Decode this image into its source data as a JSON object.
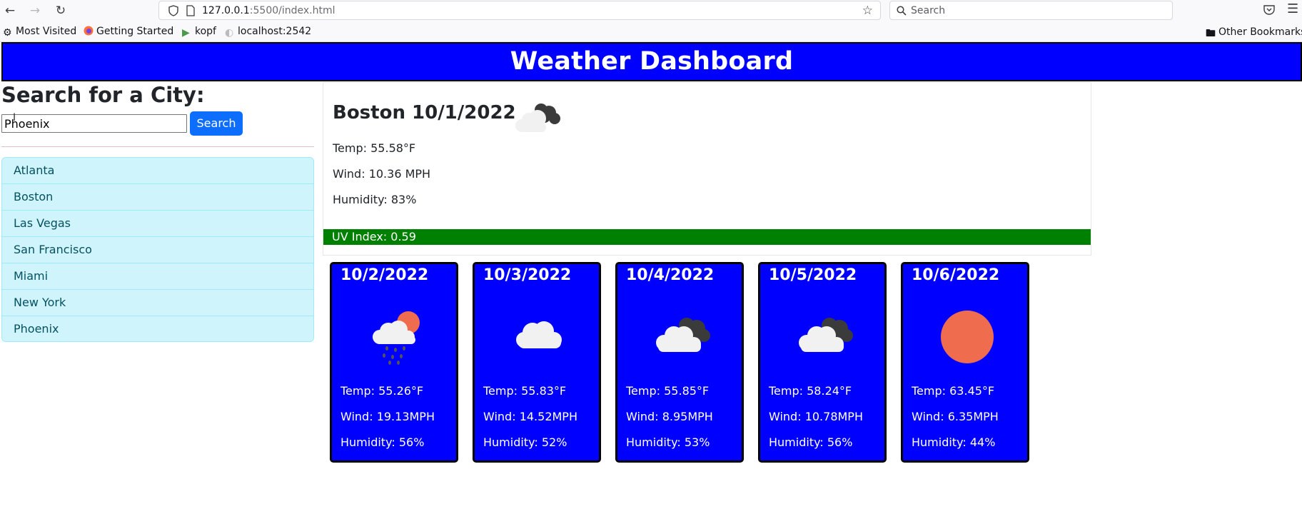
{
  "browser": {
    "url_host": "127.0.0.1",
    "url_rest": ":5500/index.html",
    "search_placeholder": "Search",
    "bookmarks": [
      "Most Visited",
      "Getting Started",
      "kopf",
      "localhost:2542"
    ],
    "other_bookmarks": "Other Bookmarks"
  },
  "header": {
    "title": "Weather Dashboard"
  },
  "search": {
    "heading": "Search for a City:",
    "input_value": "Phoenix",
    "button_label": "Search"
  },
  "cities": [
    "Atlanta",
    "Boston",
    "Las Vegas",
    "San Francisco",
    "Miami",
    "New York",
    "Phoenix"
  ],
  "current": {
    "title": "Boston 10/1/2022",
    "icon": "partly-cloudy-dark-icon",
    "temp": "Temp: 55.58°F",
    "wind": "Wind: 10.36 MPH",
    "humidity": "Humidity: 83%",
    "uv": "UV Index: 0.59"
  },
  "forecast": [
    {
      "date": "10/2/2022",
      "icon": "rain-sun-icon",
      "temp": "Temp: 55.26°F",
      "wind": "Wind: 19.13MPH",
      "humidity": "Humidity: 56%"
    },
    {
      "date": "10/3/2022",
      "icon": "cloud-icon",
      "temp": "Temp: 55.83°F",
      "wind": "Wind: 14.52MPH",
      "humidity": "Humidity: 52%"
    },
    {
      "date": "10/4/2022",
      "icon": "broken-clouds-icon",
      "temp": "Temp: 55.85°F",
      "wind": "Wind: 8.95MPH",
      "humidity": "Humidity: 53%"
    },
    {
      "date": "10/5/2022",
      "icon": "broken-clouds-icon",
      "temp": "Temp: 58.24°F",
      "wind": "Wind: 10.78MPH",
      "humidity": "Humidity: 56%"
    },
    {
      "date": "10/6/2022",
      "icon": "sun-icon",
      "temp": "Temp: 63.45°F",
      "wind": "Wind: 6.35MPH",
      "humidity": "Humidity: 44%"
    }
  ],
  "colors": {
    "header_bg": "#0000ff",
    "uv_bar": "#008000",
    "button": "#0d6efd",
    "list_bg": "#cff4fc",
    "list_text": "#055160",
    "sun": "#ef6c4e"
  }
}
